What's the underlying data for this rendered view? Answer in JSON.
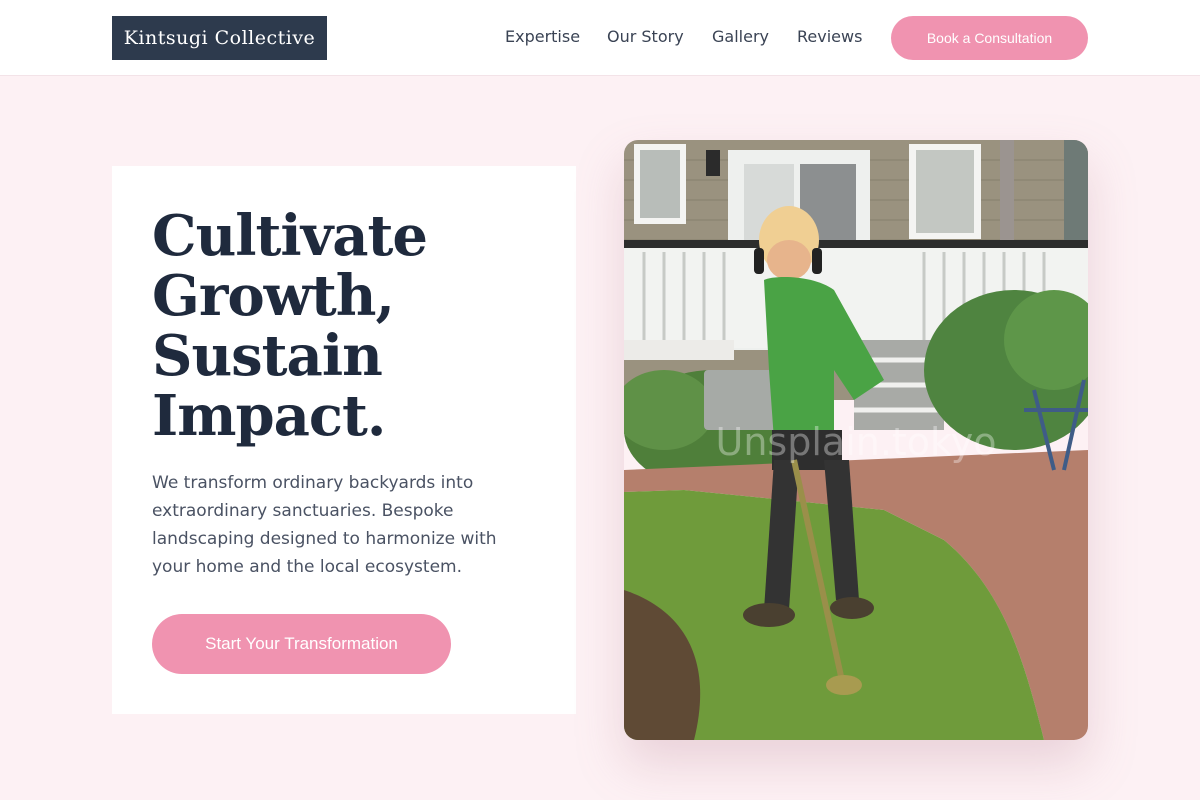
{
  "header": {
    "logo": "Kintsugi Collective",
    "nav": [
      {
        "label": "Expertise"
      },
      {
        "label": "Our Story"
      },
      {
        "label": "Gallery"
      },
      {
        "label": "Reviews"
      }
    ],
    "cta": "Book a Consultation"
  },
  "hero": {
    "headline_lines": [
      "Cultivate",
      "Growth,",
      "Sustain",
      "Impact."
    ],
    "lead": "We transform ordinary backyards into extraordinary sanctuaries. Bespoke landscaping designed to harmonize with your home and the local ecosystem.",
    "cta": "Start Your Transformation",
    "image": {
      "subject": "landscaper trimming lawn edge with string trimmer in front of a house porch",
      "watermark": "Unsplain.tokyo"
    }
  },
  "colors": {
    "background": "#fdf1f4",
    "navy": "#2d3a4d",
    "accent_pink": "#f093b0",
    "text_dark": "#1f2a3d"
  }
}
